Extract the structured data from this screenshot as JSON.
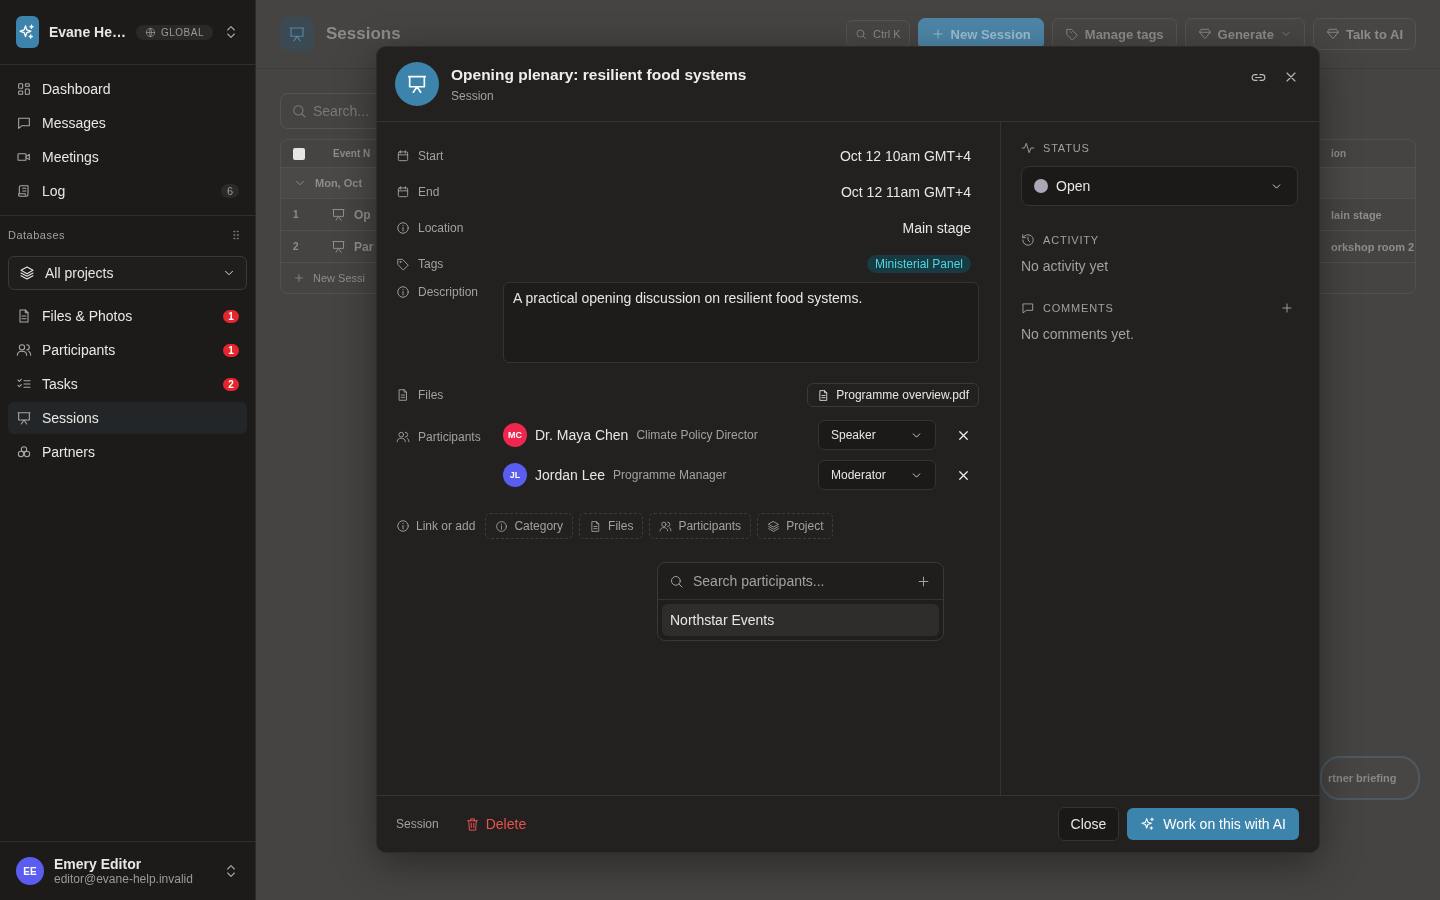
{
  "sidebar": {
    "workspace": {
      "name": "Evane He…",
      "scope": "GLOBAL"
    },
    "nav": [
      {
        "label": "Dashboard"
      },
      {
        "label": "Messages"
      },
      {
        "label": "Meetings"
      },
      {
        "label": "Log",
        "count": "6"
      }
    ],
    "databases_label": "Databases",
    "project_select": {
      "value": "All projects"
    },
    "items": [
      {
        "label": "Files & Photos",
        "badge": "1",
        "selected": false
      },
      {
        "label": "Participants",
        "badge": "1",
        "selected": false
      },
      {
        "label": "Tasks",
        "badge": "2",
        "selected": false
      },
      {
        "label": "Sessions",
        "selected": true
      },
      {
        "label": "Partners",
        "selected": false
      }
    ],
    "user": {
      "initials": "EE",
      "name": "Emery Editor",
      "email": "editor@evane-help.invalid"
    }
  },
  "page": {
    "title": "Sessions",
    "shortcut": "Ctrl K",
    "actions": [
      {
        "label": "New Session",
        "primary": true
      },
      {
        "label": "Manage tags",
        "primary": false
      },
      {
        "label": "Generate",
        "primary": false,
        "menu": true
      },
      {
        "label": "Talk to AI",
        "primary": false
      }
    ],
    "search": {
      "placeholder": "Search..."
    },
    "table": {
      "select_all": {
        "checked": false
      },
      "header": "Event N",
      "right_header": "ion",
      "group": "Mon, Oct",
      "rows": [
        {
          "number": "1",
          "name": "Op",
          "right": "lain stage"
        },
        {
          "number": "2",
          "name": "Par",
          "right": "orkshop room 2"
        }
      ],
      "add_row": "New Sessi"
    },
    "floating": "rtner briefing"
  },
  "modal": {
    "title": "Opening plenary: resilient food systems",
    "subtitle": "Session",
    "fields": [
      {
        "kind": "text",
        "label": "Start",
        "value": "Oct 12 10am GMT+4"
      },
      {
        "kind": "text",
        "label": "End",
        "value": "Oct 12 11am GMT+4"
      },
      {
        "kind": "text",
        "label": "Location",
        "value": "Main stage"
      },
      {
        "kind": "tag",
        "label": "Tags",
        "value": "Ministerial Panel"
      },
      {
        "kind": "textarea",
        "label": "Description",
        "value": "A practical opening discussion on resilient food systems."
      },
      {
        "kind": "file",
        "label": "Files",
        "value": "Programme overview.pdf"
      }
    ],
    "participants_label": "Participants",
    "participants": [
      {
        "initials": "MC",
        "name": "Dr. Maya Chen",
        "role": "Climate Policy Director",
        "part": "Speaker",
        "color": "#f0264e"
      },
      {
        "initials": "JL",
        "name": "Jordan Lee",
        "role": "Programme Manager",
        "part": "Moderator",
        "color": "#5b5cf0"
      }
    ],
    "link_label": "Link or add",
    "link_options": [
      "Category",
      "Files",
      "Participants",
      "Project"
    ],
    "picker": {
      "placeholder": "Search participants...",
      "options": [
        {
          "label": "Northstar Events",
          "selected": true
        }
      ]
    },
    "status": {
      "label": "STATUS",
      "value": "Open"
    },
    "activity": {
      "label": "ACTIVITY",
      "empty": "No activity yet"
    },
    "comments": {
      "label": "COMMENTS",
      "empty": "No comments yet."
    },
    "footer": {
      "label": "Session",
      "delete": "Delete",
      "close": "Close",
      "ai": "Work on this with AI"
    }
  }
}
